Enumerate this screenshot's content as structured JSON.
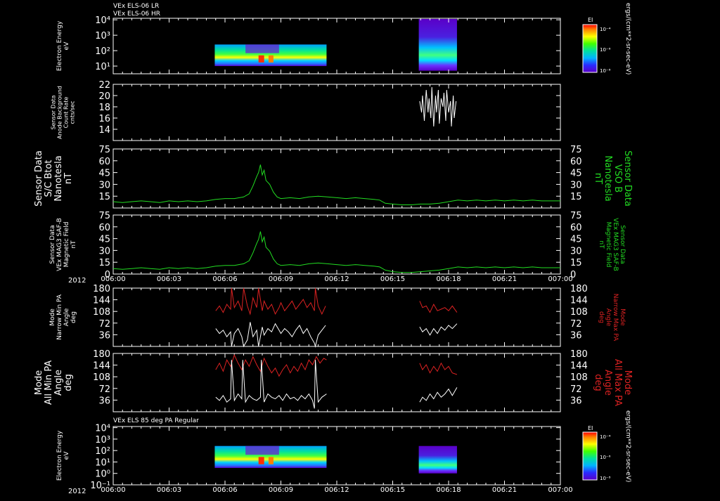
{
  "colors": {
    "background": "#000000",
    "frame": "#ffffff",
    "green": "#22dd22",
    "red": "#dd2222",
    "white": "#ffffff"
  },
  "time_axis": {
    "ticks": [
      "006:00",
      "006:03",
      "006:06",
      "006:09",
      "006:12",
      "006:15",
      "006:18",
      "006:21",
      "007:00"
    ],
    "year": "2012"
  },
  "colorbar": {
    "label": "EI",
    "ticks": [
      "10⁻⁴",
      "10⁻⁶",
      "10⁻⁸"
    ],
    "unit": "ergs/(cm**2-sr-sec-eV)"
  },
  "chart_data": [
    {
      "type": "heatmap",
      "id": "els06",
      "titles": [
        "VEx ELS-06 LR",
        "VEx ELS-06 HR"
      ],
      "ylabel": [
        "Electron Energy",
        "eV"
      ],
      "yscale": "log",
      "yticks": [
        "10⁴",
        "10³",
        "10²",
        "10¹"
      ],
      "blocks": [
        {
          "x": [
            5.45,
            11.45
          ],
          "y": [
            10,
            250
          ]
        },
        {
          "x": [
            16.4,
            18.45
          ],
          "y": [
            5,
            20000
          ]
        }
      ]
    },
    {
      "type": "line",
      "id": "bkg",
      "ylabel": [
        "Sensor Data",
        "Anode Background",
        "Count Rate",
        "cnts/sec"
      ],
      "ylim": [
        12,
        22
      ],
      "yticks": [
        "22",
        "20",
        "18",
        "16",
        "14"
      ],
      "series": [
        {
          "color": "#ffffff",
          "x": [
            16.45,
            16.55,
            16.6,
            16.7,
            16.8,
            16.9,
            16.95,
            17.05,
            17.1,
            17.2,
            17.3,
            17.35,
            17.45,
            17.5,
            17.6,
            17.7,
            17.75,
            17.85,
            17.9,
            18.0,
            18.1,
            18.15,
            18.25,
            18.3,
            18.4
          ],
          "y": [
            19,
            17,
            20,
            15.5,
            21,
            17,
            19.5,
            16,
            21.5,
            14.5,
            20,
            17,
            21,
            15,
            19.5,
            18,
            20.5,
            15.5,
            21,
            17,
            19,
            14.5,
            20,
            16,
            19
          ]
        }
      ]
    },
    {
      "type": "line",
      "id": "bmag",
      "ylabel": [
        "Sensor Data",
        "S/C Btot",
        "Nanotesla",
        "nT"
      ],
      "ylabel_right": [
        "Sensor Data",
        "VSO B",
        "Nanotesla",
        "nT"
      ],
      "ylim": [
        0,
        75
      ],
      "yticks": [
        "75",
        "60",
        "45",
        "30",
        "15"
      ],
      "series": [
        {
          "color": "#22dd22",
          "x": [
            0,
            0.5,
            1,
            1.5,
            2,
            2.5,
            3,
            3.5,
            4,
            4.5,
            5,
            5.5,
            6,
            6.5,
            7,
            7.3,
            7.5,
            7.7,
            7.8,
            7.9,
            8.0,
            8.1,
            8.2,
            8.4,
            8.6,
            8.8,
            9.0,
            9.5,
            10,
            10.5,
            11,
            11.5,
            12,
            12.5,
            13,
            13.5,
            14,
            14.3,
            14.6,
            15,
            15.5,
            16,
            16.5,
            17,
            17.5,
            18,
            18.5,
            19,
            19.5,
            20,
            20.5,
            21,
            21.5,
            22,
            22.5,
            23,
            23.5,
            24
          ],
          "y": [
            8,
            7,
            8,
            9,
            8,
            7,
            9,
            8,
            9,
            8,
            9,
            11,
            12,
            12,
            14,
            18,
            28,
            40,
            45,
            55,
            42,
            48,
            35,
            30,
            20,
            14,
            12,
            13,
            12,
            14,
            15,
            14,
            13,
            12,
            13,
            12,
            11,
            10,
            6,
            5,
            4,
            4,
            5,
            5,
            6,
            8,
            10,
            9,
            10,
            9,
            10,
            9,
            10,
            9,
            10,
            9,
            9,
            9
          ]
        }
      ]
    },
    {
      "type": "line",
      "id": "mag3",
      "ylabel": [
        "Sensor Data",
        "VEx MAG3 SAF-B",
        "Magnetic Field",
        "nT"
      ],
      "ylabel_right": [
        "Sensor Data",
        "VEx MAG3 SAF-B",
        "Magnetic Field",
        "nT"
      ],
      "ylim": [
        0,
        75
      ],
      "yticks": [
        "75",
        "60",
        "45",
        "30",
        "15",
        "0"
      ],
      "series": [
        {
          "color": "#22dd22",
          "x": [
            0,
            0.5,
            1,
            1.5,
            2,
            2.5,
            3,
            3.5,
            4,
            4.5,
            5,
            5.5,
            6,
            6.5,
            7,
            7.3,
            7.5,
            7.7,
            7.8,
            7.9,
            8.0,
            8.1,
            8.2,
            8.4,
            8.6,
            8.8,
            9.0,
            9.5,
            10,
            10.5,
            11,
            11.5,
            12,
            12.5,
            13,
            13.5,
            14,
            14.3,
            14.6,
            15,
            15.5,
            16,
            16.5,
            17,
            17.5,
            18,
            18.5,
            19,
            19.5,
            20,
            20.5,
            21,
            21.5,
            22,
            22.5,
            23,
            23.5,
            24
          ],
          "y": [
            7,
            6,
            7,
            8,
            7,
            6,
            8,
            7,
            8,
            7,
            8,
            10,
            11,
            11,
            13,
            17,
            27,
            39,
            44,
            54,
            41,
            47,
            34,
            29,
            19,
            13,
            11,
            12,
            11,
            13,
            14,
            13,
            12,
            11,
            12,
            11,
            10,
            9,
            5,
            3,
            2,
            2,
            3,
            4,
            5,
            7,
            9,
            8,
            9,
            8,
            9,
            8,
            9,
            8,
            9,
            8,
            8,
            8
          ]
        }
      ]
    },
    {
      "type": "line",
      "id": "narrowpa",
      "ylabel": [
        "Mode",
        "Narrow Min PA",
        "Angle",
        "deg"
      ],
      "ylabel_right": [
        "Mode",
        "Narrow Max PA",
        "Angle",
        "deg"
      ],
      "ylim": [
        0,
        180
      ],
      "yticks": [
        "180",
        "144",
        "108",
        "72",
        "36"
      ],
      "series": [
        {
          "color": "#dd2222",
          "x": [
            5.5,
            5.7,
            5.9,
            6.1,
            6.3,
            6.35,
            6.5,
            6.7,
            6.9,
            7.0,
            7.2,
            7.35,
            7.5,
            7.7,
            7.8,
            8.0,
            8.1,
            8.3,
            8.5,
            8.7,
            8.9,
            9.0,
            9.2,
            9.4,
            9.6,
            9.8,
            10.0,
            10.2,
            10.4,
            10.6,
            10.8,
            10.85,
            11.0,
            11.2,
            11.4,
            16.45,
            16.6,
            16.8,
            17.0,
            17.2,
            17.4,
            17.6,
            17.8,
            18.0,
            18.2,
            18.45
          ],
          "y": [
            110,
            125,
            105,
            130,
            115,
            180,
            120,
            140,
            110,
            180,
            125,
            100,
            150,
            120,
            180,
            110,
            140,
            115,
            130,
            100,
            120,
            135,
            110,
            125,
            140,
            115,
            130,
            145,
            120,
            135,
            110,
            180,
            125,
            100,
            125,
            140,
            120,
            125,
            105,
            130,
            110,
            115,
            120,
            110,
            125,
            105
          ]
        },
        {
          "color": "#ffffff",
          "x": [
            5.5,
            5.7,
            5.9,
            6.1,
            6.3,
            6.35,
            6.5,
            6.7,
            6.9,
            7.0,
            7.2,
            7.35,
            7.5,
            7.7,
            7.8,
            8.0,
            8.1,
            8.3,
            8.5,
            8.7,
            8.9,
            9.0,
            9.2,
            9.4,
            9.6,
            9.8,
            10.0,
            10.2,
            10.4,
            10.6,
            10.8,
            10.85,
            11.0,
            11.2,
            11.4,
            16.45,
            16.6,
            16.8,
            17.0,
            17.2,
            17.4,
            17.6,
            17.8,
            18.0,
            18.2,
            18.45
          ],
          "y": [
            55,
            40,
            50,
            30,
            45,
            0,
            40,
            55,
            30,
            0,
            20,
            75,
            30,
            50,
            0,
            60,
            35,
            55,
            45,
            70,
            50,
            40,
            55,
            45,
            30,
            50,
            65,
            40,
            55,
            30,
            10,
            0,
            35,
            50,
            65,
            60,
            45,
            55,
            35,
            55,
            40,
            60,
            50,
            65,
            55,
            70
          ]
        }
      ]
    },
    {
      "type": "line",
      "id": "allpa",
      "ylabel": [
        "Mode",
        "All Min PA",
        "Angle",
        "deg"
      ],
      "ylabel_right": [
        "Mode",
        "All Max PA",
        "Angle",
        "deg"
      ],
      "ylim": [
        0,
        180
      ],
      "yticks": [
        "180",
        "144",
        "108",
        "72",
        "36"
      ],
      "series": [
        {
          "color": "#dd2222",
          "x": [
            5.5,
            5.7,
            5.9,
            6.1,
            6.3,
            6.5,
            6.7,
            6.9,
            7.1,
            7.3,
            7.5,
            7.7,
            7.9,
            8.1,
            8.3,
            8.5,
            8.7,
            8.9,
            9.1,
            9.3,
            9.5,
            9.7,
            9.9,
            10.1,
            10.3,
            10.5,
            10.7,
            10.9,
            11.1,
            11.3,
            11.45,
            16.45,
            16.6,
            16.8,
            17.0,
            17.2,
            17.4,
            17.6,
            17.8,
            18.0,
            18.2,
            18.45
          ],
          "y": [
            130,
            150,
            125,
            160,
            140,
            175,
            150,
            130,
            160,
            140,
            170,
            145,
            125,
            165,
            140,
            120,
            135,
            110,
            130,
            145,
            120,
            140,
            125,
            150,
            130,
            160,
            145,
            170,
            150,
            165,
            160,
            150,
            130,
            145,
            120,
            140,
            125,
            150,
            130,
            140,
            120,
            115
          ]
        },
        {
          "color": "#ffffff",
          "x": [
            5.5,
            5.7,
            5.9,
            6.1,
            6.3,
            6.35,
            6.5,
            6.7,
            6.9,
            6.95,
            7.1,
            7.3,
            7.5,
            7.7,
            7.9,
            7.95,
            8.1,
            8.3,
            8.5,
            8.7,
            8.9,
            9.1,
            9.3,
            9.5,
            9.7,
            9.9,
            10.1,
            10.3,
            10.5,
            10.7,
            10.8,
            10.85,
            11.0,
            11.2,
            11.45,
            16.45,
            16.6,
            16.8,
            17.0,
            17.2,
            17.4,
            17.6,
            17.8,
            18.0,
            18.2,
            18.45
          ],
          "y": [
            45,
            35,
            50,
            30,
            40,
            160,
            35,
            55,
            40,
            160,
            30,
            50,
            40,
            35,
            45,
            160,
            30,
            55,
            45,
            40,
            50,
            35,
            55,
            40,
            45,
            35,
            50,
            40,
            55,
            35,
            10,
            160,
            30,
            45,
            55,
            30,
            45,
            35,
            55,
            40,
            60,
            45,
            55,
            70,
            50,
            75
          ]
        }
      ]
    },
    {
      "type": "heatmap",
      "id": "els85",
      "titles": [
        "VEx ELS 85 deg PA Regular"
      ],
      "ylabel": [
        "Electron Energy",
        "eV"
      ],
      "yscale": "log",
      "yticks": [
        "10⁴",
        "10³",
        "10²",
        "10¹",
        "10⁰",
        "10⁻¹"
      ],
      "blocks": [
        {
          "x": [
            5.45,
            11.45
          ],
          "y": [
            3,
            250
          ]
        },
        {
          "x": [
            16.4,
            18.45
          ],
          "y": [
            1,
            250
          ]
        }
      ]
    }
  ]
}
